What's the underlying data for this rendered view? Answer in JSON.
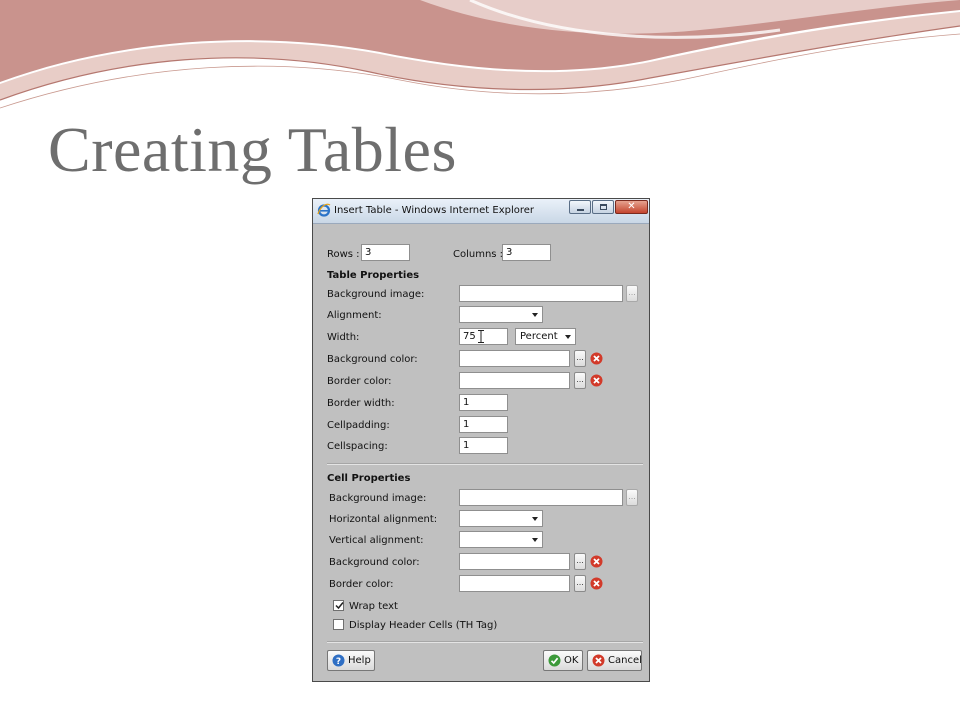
{
  "slide": {
    "title": "Creating Tables"
  },
  "window": {
    "title": "Insert Table - Windows Internet Explorer",
    "close_glyph": "✕"
  },
  "top": {
    "rows_label": "Rows :",
    "rows_value": "3",
    "columns_label": "Columns :",
    "columns_value": "3"
  },
  "table_props": {
    "heading": "Table Properties",
    "background_image_label": "Background image:",
    "background_image_value": "",
    "alignment_label": "Alignment:",
    "alignment_value": "",
    "width_label": "Width:",
    "width_value": "75",
    "width_unit": "Percent",
    "background_color_label": "Background color:",
    "background_color_value": "",
    "border_color_label": "Border color:",
    "border_color_value": "",
    "border_width_label": "Border width:",
    "border_width_value": "1",
    "cellpadding_label": "Cellpadding:",
    "cellpadding_value": "1",
    "cellspacing_label": "Cellspacing:",
    "cellspacing_value": "1"
  },
  "cell_props": {
    "heading": "Cell Properties",
    "background_image_label": "Background image:",
    "background_image_value": "",
    "horizontal_alignment_label": "Horizontal alignment:",
    "horizontal_alignment_value": "",
    "vertical_alignment_label": "Vertical alignment:",
    "vertical_alignment_value": "",
    "background_color_label": "Background color:",
    "background_color_value": "",
    "border_color_label": "Border color:",
    "border_color_value": ""
  },
  "options": {
    "wrap_text_label": "Wrap text",
    "wrap_text_checked": true,
    "header_cells_label": "Display Header Cells (TH Tag)",
    "header_cells_checked": false
  },
  "buttons": {
    "browse_label": "...",
    "help_label": "Help",
    "ok_label": "OK",
    "cancel_label": "Cancel"
  },
  "colors": {
    "title_text": "#6e6e6e",
    "dialog_bg": "#c0c0c0",
    "swoosh_dark": "#c98f8a",
    "swoosh_light": "#e3c1b9",
    "clear_red": "#d23a2a",
    "ok_green": "#3c9a3a",
    "help_blue": "#2f6fc4"
  },
  "icons": [
    "ie-logo-icon",
    "minimize-icon",
    "maximize-icon",
    "close-icon",
    "clear-color-icon",
    "checkmark-icon",
    "help-icon",
    "ok-icon",
    "cancel-icon",
    "text-cursor-icon"
  ]
}
